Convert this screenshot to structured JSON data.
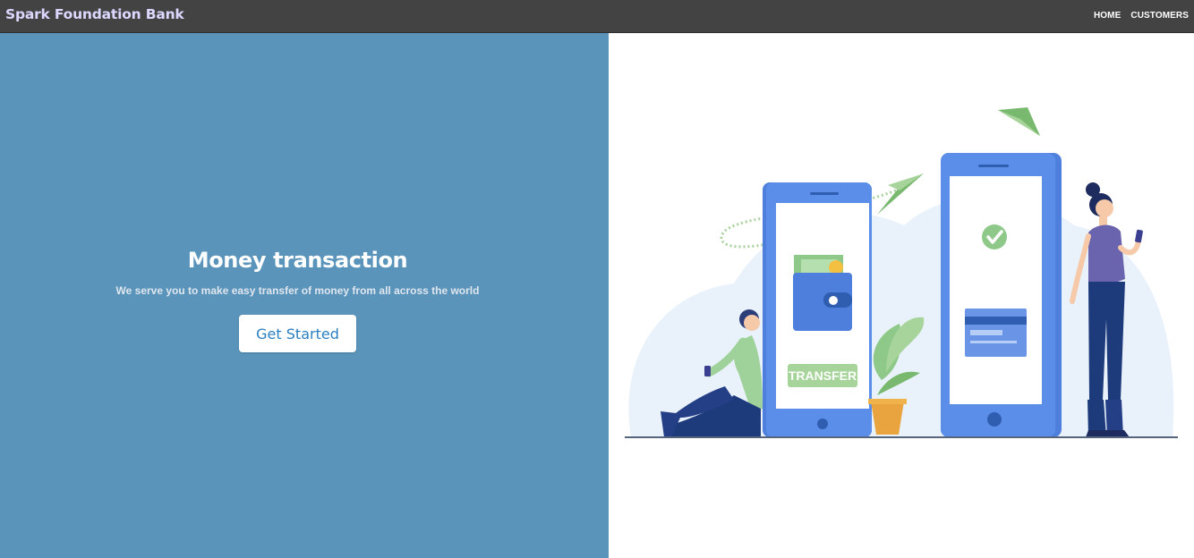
{
  "navbar": {
    "brand": "Spark Foundation Bank",
    "links": [
      {
        "label": "HOME"
      },
      {
        "label": "CUSTOMERS"
      }
    ]
  },
  "hero": {
    "title": "Money transaction",
    "subtitle": "We serve you to make easy transfer of money from all across the world",
    "cta_label": "Get Started"
  },
  "illustration": {
    "transfer_label": "TRANSFER"
  },
  "colors": {
    "navbar_bg": "#434343",
    "brand_text": "#dcd8ff",
    "hero_bg": "#5a94bb",
    "cta_text": "#2a7fc0",
    "phone_blue": "#5b8ee8",
    "accent_green": "#8fc98a"
  }
}
